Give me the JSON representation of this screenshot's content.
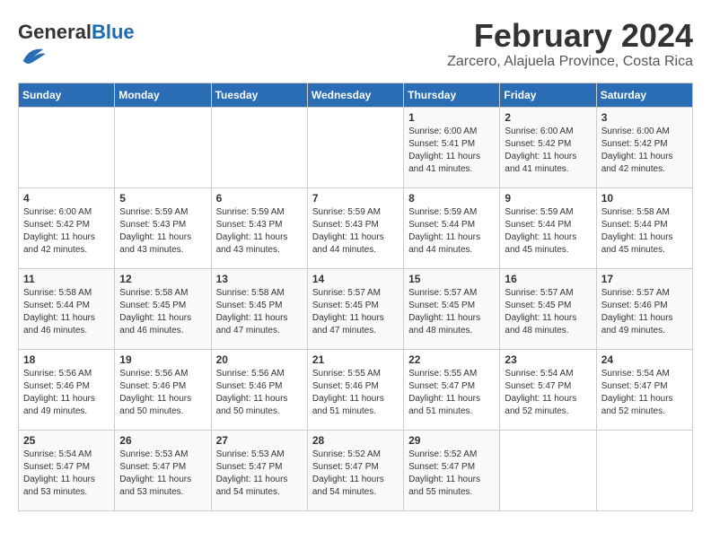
{
  "header": {
    "logo_general": "General",
    "logo_blue": "Blue",
    "month": "February 2024",
    "location": "Zarcero, Alajuela Province, Costa Rica"
  },
  "weekdays": [
    "Sunday",
    "Monday",
    "Tuesday",
    "Wednesday",
    "Thursday",
    "Friday",
    "Saturday"
  ],
  "weeks": [
    [
      {
        "day": "",
        "info": ""
      },
      {
        "day": "",
        "info": ""
      },
      {
        "day": "",
        "info": ""
      },
      {
        "day": "",
        "info": ""
      },
      {
        "day": "1",
        "info": "Sunrise: 6:00 AM\nSunset: 5:41 PM\nDaylight: 11 hours\nand 41 minutes."
      },
      {
        "day": "2",
        "info": "Sunrise: 6:00 AM\nSunset: 5:42 PM\nDaylight: 11 hours\nand 41 minutes."
      },
      {
        "day": "3",
        "info": "Sunrise: 6:00 AM\nSunset: 5:42 PM\nDaylight: 11 hours\nand 42 minutes."
      }
    ],
    [
      {
        "day": "4",
        "info": "Sunrise: 6:00 AM\nSunset: 5:42 PM\nDaylight: 11 hours\nand 42 minutes."
      },
      {
        "day": "5",
        "info": "Sunrise: 5:59 AM\nSunset: 5:43 PM\nDaylight: 11 hours\nand 43 minutes."
      },
      {
        "day": "6",
        "info": "Sunrise: 5:59 AM\nSunset: 5:43 PM\nDaylight: 11 hours\nand 43 minutes."
      },
      {
        "day": "7",
        "info": "Sunrise: 5:59 AM\nSunset: 5:43 PM\nDaylight: 11 hours\nand 44 minutes."
      },
      {
        "day": "8",
        "info": "Sunrise: 5:59 AM\nSunset: 5:44 PM\nDaylight: 11 hours\nand 44 minutes."
      },
      {
        "day": "9",
        "info": "Sunrise: 5:59 AM\nSunset: 5:44 PM\nDaylight: 11 hours\nand 45 minutes."
      },
      {
        "day": "10",
        "info": "Sunrise: 5:58 AM\nSunset: 5:44 PM\nDaylight: 11 hours\nand 45 minutes."
      }
    ],
    [
      {
        "day": "11",
        "info": "Sunrise: 5:58 AM\nSunset: 5:44 PM\nDaylight: 11 hours\nand 46 minutes."
      },
      {
        "day": "12",
        "info": "Sunrise: 5:58 AM\nSunset: 5:45 PM\nDaylight: 11 hours\nand 46 minutes."
      },
      {
        "day": "13",
        "info": "Sunrise: 5:58 AM\nSunset: 5:45 PM\nDaylight: 11 hours\nand 47 minutes."
      },
      {
        "day": "14",
        "info": "Sunrise: 5:57 AM\nSunset: 5:45 PM\nDaylight: 11 hours\nand 47 minutes."
      },
      {
        "day": "15",
        "info": "Sunrise: 5:57 AM\nSunset: 5:45 PM\nDaylight: 11 hours\nand 48 minutes."
      },
      {
        "day": "16",
        "info": "Sunrise: 5:57 AM\nSunset: 5:45 PM\nDaylight: 11 hours\nand 48 minutes."
      },
      {
        "day": "17",
        "info": "Sunrise: 5:57 AM\nSunset: 5:46 PM\nDaylight: 11 hours\nand 49 minutes."
      }
    ],
    [
      {
        "day": "18",
        "info": "Sunrise: 5:56 AM\nSunset: 5:46 PM\nDaylight: 11 hours\nand 49 minutes."
      },
      {
        "day": "19",
        "info": "Sunrise: 5:56 AM\nSunset: 5:46 PM\nDaylight: 11 hours\nand 50 minutes."
      },
      {
        "day": "20",
        "info": "Sunrise: 5:56 AM\nSunset: 5:46 PM\nDaylight: 11 hours\nand 50 minutes."
      },
      {
        "day": "21",
        "info": "Sunrise: 5:55 AM\nSunset: 5:46 PM\nDaylight: 11 hours\nand 51 minutes."
      },
      {
        "day": "22",
        "info": "Sunrise: 5:55 AM\nSunset: 5:47 PM\nDaylight: 11 hours\nand 51 minutes."
      },
      {
        "day": "23",
        "info": "Sunrise: 5:54 AM\nSunset: 5:47 PM\nDaylight: 11 hours\nand 52 minutes."
      },
      {
        "day": "24",
        "info": "Sunrise: 5:54 AM\nSunset: 5:47 PM\nDaylight: 11 hours\nand 52 minutes."
      }
    ],
    [
      {
        "day": "25",
        "info": "Sunrise: 5:54 AM\nSunset: 5:47 PM\nDaylight: 11 hours\nand 53 minutes."
      },
      {
        "day": "26",
        "info": "Sunrise: 5:53 AM\nSunset: 5:47 PM\nDaylight: 11 hours\nand 53 minutes."
      },
      {
        "day": "27",
        "info": "Sunrise: 5:53 AM\nSunset: 5:47 PM\nDaylight: 11 hours\nand 54 minutes."
      },
      {
        "day": "28",
        "info": "Sunrise: 5:52 AM\nSunset: 5:47 PM\nDaylight: 11 hours\nand 54 minutes."
      },
      {
        "day": "29",
        "info": "Sunrise: 5:52 AM\nSunset: 5:47 PM\nDaylight: 11 hours\nand 55 minutes."
      },
      {
        "day": "",
        "info": ""
      },
      {
        "day": "",
        "info": ""
      }
    ]
  ]
}
